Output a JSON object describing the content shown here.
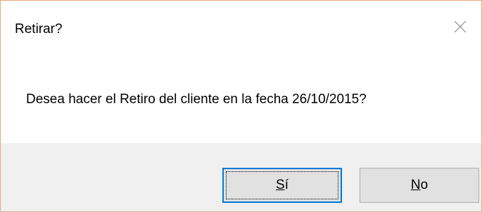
{
  "dialog": {
    "title": "Retirar?",
    "message": "Desea hacer el Retiro del cliente en la fecha 26/10/2015?",
    "close_icon": "close-icon",
    "buttons": {
      "yes": {
        "mnemonic": "S",
        "rest": "í"
      },
      "no": {
        "mnemonic": "N",
        "rest": "o"
      }
    }
  },
  "colors": {
    "accent": "#0078d7",
    "window_border": "#e8a878",
    "footer_bg": "#f0f0f0",
    "button_bg": "#e1e1e1"
  }
}
